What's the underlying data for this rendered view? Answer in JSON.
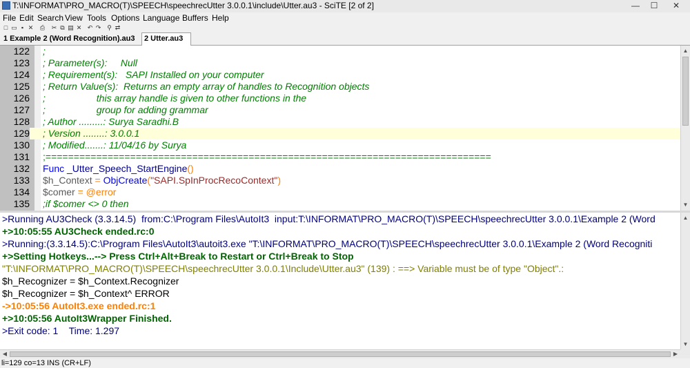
{
  "window": {
    "title": "T:\\INFORMAT\\PRO_MACRO(T)\\SPEECH\\speechrecUtter 3.0.0.1\\include\\Utter.au3 - SciTE [2 of 2]",
    "minimize_glyph": "—",
    "maximize_glyph": "☐",
    "close_glyph": "✕"
  },
  "menu": [
    "File",
    "Edit",
    "Search",
    "View",
    "Tools",
    "Options",
    "Language",
    "Buffers",
    "Help"
  ],
  "toolbar": {
    "icons": [
      "new-file-icon",
      "open-file-icon",
      "save-icon",
      "close-file-icon",
      "print-icon",
      "cut-icon",
      "copy-icon",
      "paste-icon",
      "delete-icon",
      "undo-icon",
      "redo-icon",
      "find-icon",
      "replace-icon"
    ],
    "glyphs": [
      "□",
      "▭",
      "▪",
      "✕",
      "⎙",
      "✂",
      "⧉",
      "▤",
      "✕",
      "↶",
      "↷",
      "⚲",
      "⇄"
    ]
  },
  "tabs": [
    {
      "label": "1 Example 2 (Word Recognition).au3",
      "active": false
    },
    {
      "label": "2 Utter.au3",
      "active": true
    }
  ],
  "editor": {
    "caret_line": 129,
    "lines": [
      {
        "num": "122",
        "text": ";"
      },
      {
        "num": "123",
        "text": "; Parameter(s):     Null"
      },
      {
        "num": "124",
        "text": "; Requirement(s):   SAPI Installed on your computer"
      },
      {
        "num": "125",
        "text": "; Return Value(s):  Returns an empty array of handles to Recognition objects"
      },
      {
        "num": "126",
        "text": ";                   this array handle is given to other functions in the"
      },
      {
        "num": "127",
        "text": ";                   group for adding grammar"
      },
      {
        "num": "128",
        "text": "; Author .........: Surya Saradhi.B"
      },
      {
        "num": "129",
        "text": "; Version ........: 3.0.0.1"
      },
      {
        "num": "130",
        "text": "; Modified.......: 11/04/16 by Surya"
      },
      {
        "num": "131",
        "text": ";==============================================================================="
      },
      {
        "num": "132",
        "kw": "Func",
        "rest": " _Utter_Speech_StartEngine",
        "paren": "()"
      },
      {
        "num": "133",
        "var": "$h_Context",
        "op": " = ",
        "func": "ObjCreate",
        "p1": "(",
        "str": "\"SAPI.SpInProcRecoContext\"",
        "p2": ")"
      },
      {
        "num": "134",
        "var": "$comer",
        "op": " = ",
        "macro": "@error"
      },
      {
        "num": "135",
        "text": ";if $comer <> 0 then"
      }
    ]
  },
  "output": {
    "lines": [
      {
        "text": ">Running AU3Check (3.3.14.5)  from:C:\\Program Files\\AutoIt3  input:T:\\INFORMAT\\PRO_MACRO(T)\\SPEECH\\speechrecUtter 3.0.0.1\\Example 2 (Word",
        "style": "blue"
      },
      {
        "text": "+>10:05:55 AU3Check ended.rc:0",
        "style": "green"
      },
      {
        "text": ">Running:(3.3.14.5):C:\\Program Files\\AutoIt3\\autoit3.exe \"T:\\INFORMAT\\PRO_MACRO(T)\\SPEECH\\speechrecUtter 3.0.0.1\\Example 2 (Word Recogniti",
        "style": "blue"
      },
      {
        "text": "+>Setting Hotkeys...--> Press Ctrl+Alt+Break to Restart or Ctrl+Break to Stop",
        "style": "green"
      },
      {
        "text": "\"T:\\INFORMAT\\PRO_MACRO(T)\\SPEECH\\speechrecUtter 3.0.0.1\\Include\\Utter.au3\" (139) : ==> Variable must be of type \"Object\".:",
        "style": "olive"
      },
      {
        "text": "$h_Recognizer = $h_Context.Recognizer",
        "style": "black"
      },
      {
        "text": "$h_Recognizer = $h_Context^ ERROR",
        "style": "black"
      },
      {
        "text": "->10:05:56 AutoIt3.exe ended.rc:1",
        "style": "orange"
      },
      {
        "text": "+>10:05:56 AutoIt3Wrapper Finished.",
        "style": "green"
      },
      {
        "text": ">Exit code: 1    Time: 1.297",
        "style": "blue"
      }
    ]
  },
  "statusbar": {
    "text": "li=129 co=13 INS (CR+LF)"
  },
  "scroll_glyphs": {
    "up": "▲",
    "down": "▼",
    "left": "◀",
    "right": "▶"
  }
}
